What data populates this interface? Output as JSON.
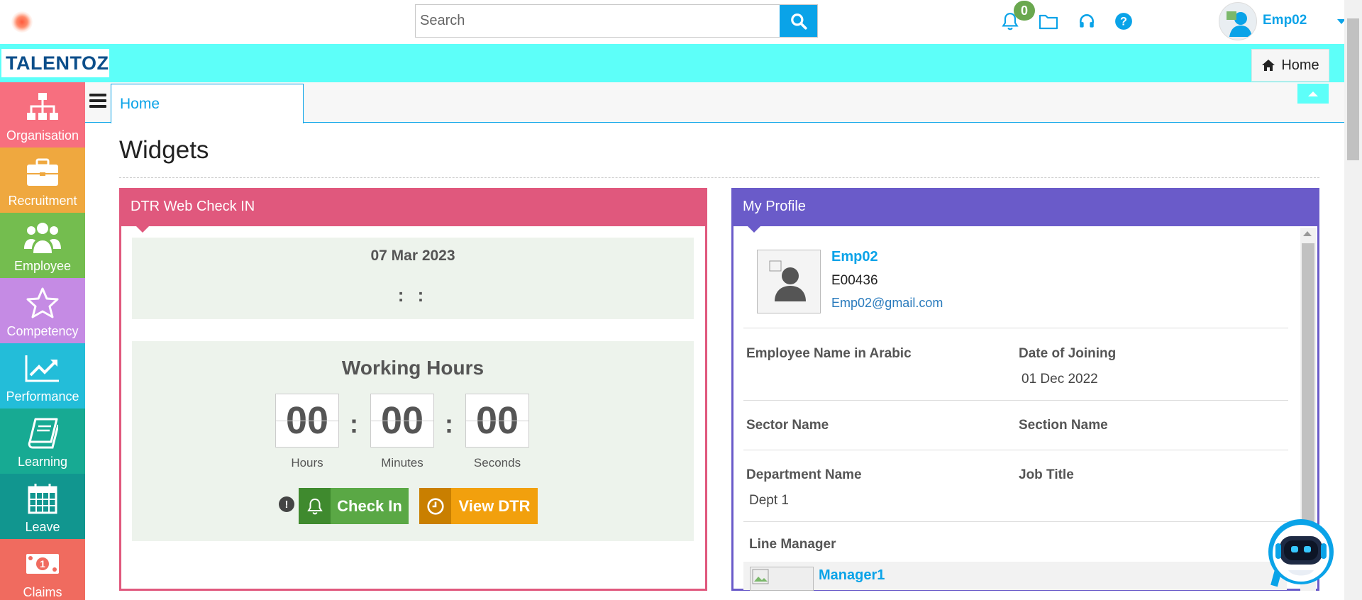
{
  "search": {
    "placeholder": "Search"
  },
  "topbar": {
    "notification_count": "0",
    "user_name": "Emp02"
  },
  "brand": {
    "logo_text": "TALENTOZ"
  },
  "breadcrumb": {
    "home_label": "Home"
  },
  "sidebar": {
    "items": [
      {
        "label": "Organisation",
        "icon": "org-chart-icon",
        "color": "#f76f7f"
      },
      {
        "label": "Recruitment",
        "icon": "briefcase-icon",
        "color": "#efa83f"
      },
      {
        "label": "Employee",
        "icon": "group-icon",
        "color": "#74bd4f"
      },
      {
        "label": "Competency",
        "icon": "star-icon",
        "color": "#c58be4"
      },
      {
        "label": "Performance",
        "icon": "trend-chart-icon",
        "color": "#23bdd9"
      },
      {
        "label": "Learning",
        "icon": "book-icon",
        "color": "#17aa93"
      },
      {
        "label": "Leave",
        "icon": "calendar-icon",
        "color": "#11968f"
      },
      {
        "label": "Claims",
        "icon": "money-icon",
        "color": "#f06b5f"
      }
    ]
  },
  "tabs": {
    "home_label": "Home"
  },
  "page": {
    "title": "Widgets"
  },
  "dtr": {
    "title": "DTR Web Check IN",
    "date": "07 Mar 2023",
    "time": ": :",
    "working_hours_title": "Working Hours",
    "hours": "00",
    "minutes": "00",
    "seconds": "00",
    "hours_label": "Hours",
    "minutes_label": "Minutes",
    "seconds_label": "Seconds",
    "check_in_label": "Check In",
    "view_dtr_label": "View DTR",
    "colors": {
      "header": "#e0587d",
      "check_in": "#5aa845",
      "view_dtr": "#f2a00d"
    }
  },
  "profile": {
    "title": "My Profile",
    "name": "Emp02",
    "employee_id": "E00436",
    "email": "Emp02@gmail.com",
    "fields": {
      "arabic_name_label": "Employee Name in Arabic",
      "arabic_name_value": "",
      "doj_label": "Date of Joining",
      "doj_value": "01 Dec 2022",
      "sector_label": "Sector Name",
      "sector_value": "",
      "section_label": "Section Name",
      "section_value": "",
      "department_label": "Department Name",
      "department_value": "Dept 1",
      "job_title_label": "Job Title",
      "job_title_value": "",
      "line_manager_label": "Line Manager",
      "line_manager_name": "Manager1"
    },
    "colors": {
      "header": "#6a5bc9"
    }
  },
  "colors": {
    "accent": "#0aa3e8",
    "brand_band": "#5dfff9"
  }
}
